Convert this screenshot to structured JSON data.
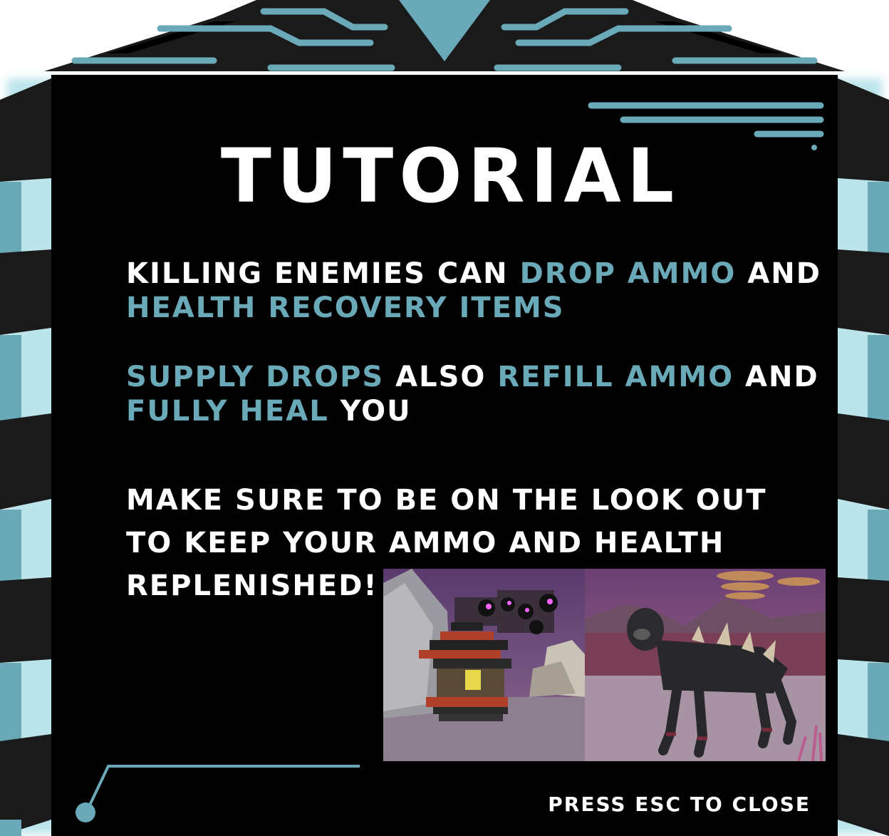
{
  "title": "TUTORIAL",
  "paragraphs": {
    "p1": {
      "t1": "KILLING ENEMIES CAN ",
      "h1": "DROP AMMO",
      "t2": " AND ",
      "h2": "HEALTH RECOVERY ITEMS"
    },
    "p2": {
      "h1": "SUPPLY DROPS",
      "t1": " ALSO ",
      "h2": "REFILL AMMO",
      "t2": " AND ",
      "h3": "FULLY HEAL",
      "t3": " YOU"
    },
    "p3": {
      "t1": "MAKE SURE TO BE ON THE LOOK OUT TO KEEP YOUR AMMO AND HEALTH REPLENISHED!"
    }
  },
  "close_hint": "PRESS ESC TO CLOSE",
  "colors": {
    "accent": "#6aa9b8",
    "panel": "#000000",
    "frame": "#1a1a1a",
    "text": "#ffffff"
  },
  "screenshots": [
    {
      "name": "supply-drop-screenshot"
    },
    {
      "name": "spiked-creature-screenshot"
    }
  ]
}
